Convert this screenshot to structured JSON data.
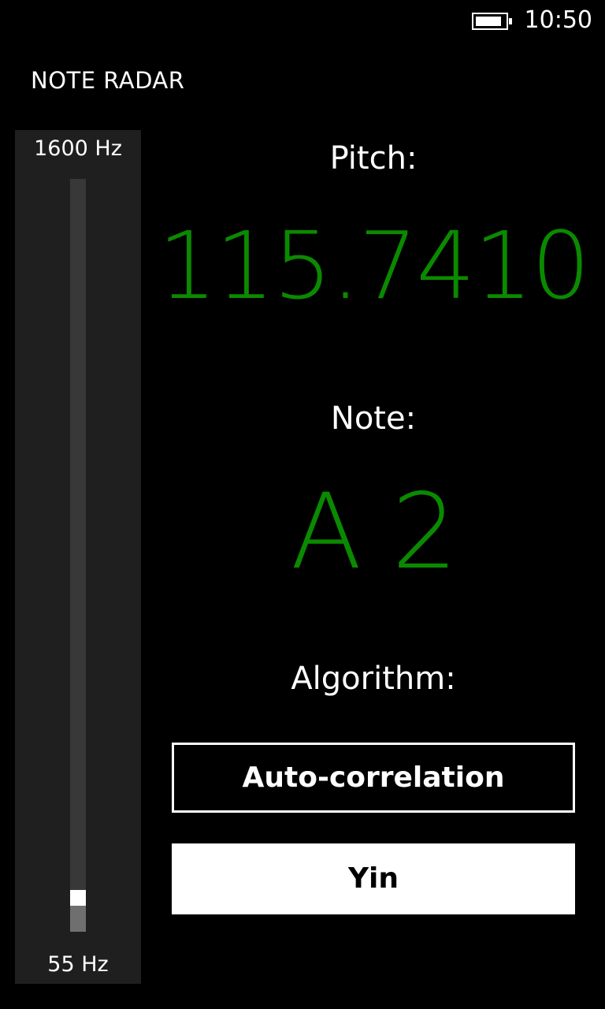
{
  "status_bar": {
    "time": "10:50",
    "battery_level": 0.9,
    "battery_icon": "battery-icon"
  },
  "app": {
    "title": "NOTE RADAR"
  },
  "range_slider": {
    "max_label": "1600 Hz",
    "min_label": "55 Hz",
    "level": 0.035
  },
  "pitch": {
    "label": "Pitch:",
    "value": "115.7410"
  },
  "note": {
    "label": "Note:",
    "value": "A 2"
  },
  "algorithm": {
    "label": "Algorithm:",
    "options": [
      {
        "label": "Auto-correlation",
        "selected": false
      },
      {
        "label": "Yin",
        "selected": true
      }
    ]
  },
  "colors": {
    "accent": "#0a8a00",
    "background": "#000000",
    "panel": "#1f1f1f"
  }
}
